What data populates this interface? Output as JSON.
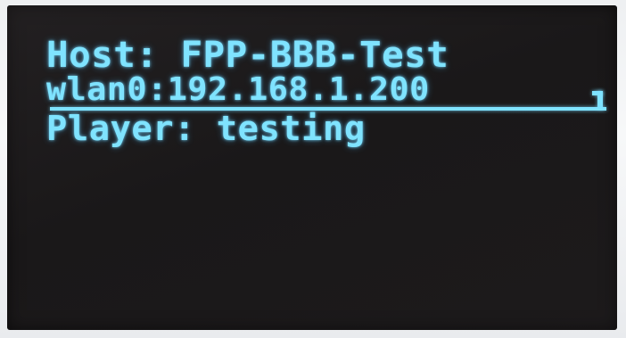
{
  "display": {
    "host_line": "Host: FPP-BBB-Test",
    "network_line": "wlan0:192.168.1.200",
    "player_line": "Player: testing",
    "text_color": "#7fe3ff",
    "background_color": "#1a1819"
  }
}
